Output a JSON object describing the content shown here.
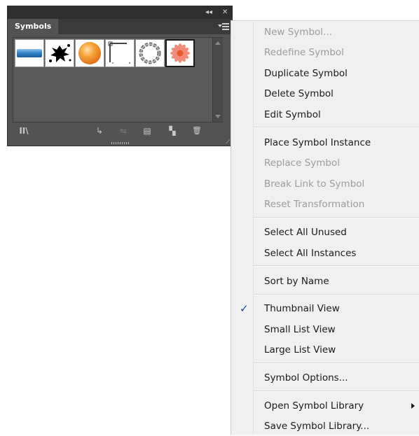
{
  "panel": {
    "tab_label": "Symbols",
    "collapse_glyph": "◂◂",
    "close_glyph": "✕",
    "thumbnails": [
      {
        "name": "blue-bar-symbol-icon",
        "color": "#2f7fc4"
      },
      {
        "name": "ink-splat-symbol-icon",
        "color": "#000000"
      },
      {
        "name": "orange-ball-symbol-icon",
        "color": "#f08a1c"
      },
      {
        "name": "frame-corner-symbol-icon",
        "color": "#555555"
      },
      {
        "name": "chain-ring-symbol-icon",
        "color": "#777777"
      },
      {
        "name": "flower-symbol-icon",
        "color": "#f07060"
      }
    ],
    "footer": {
      "library_glyph": "II\\",
      "place_glyph": "↳",
      "break_link_glyph": "⇋",
      "options_glyph": "▤",
      "new_glyph": "▚",
      "delete_glyph": "🗑"
    }
  },
  "menu": {
    "items": [
      {
        "label": "New Symbol...",
        "enabled": false
      },
      {
        "label": "Redefine Symbol",
        "enabled": false
      },
      {
        "label": "Duplicate Symbol",
        "enabled": true
      },
      {
        "label": "Delete Symbol",
        "enabled": true
      },
      {
        "label": "Edit Symbol",
        "enabled": true
      },
      {
        "label": "Place Symbol Instance",
        "enabled": true
      },
      {
        "label": "Replace Symbol",
        "enabled": false
      },
      {
        "label": "Break Link to Symbol",
        "enabled": false
      },
      {
        "label": "Reset Transformation",
        "enabled": false
      },
      {
        "label": "Select All Unused",
        "enabled": true
      },
      {
        "label": "Select All Instances",
        "enabled": true
      },
      {
        "label": "Sort by Name",
        "enabled": true
      },
      {
        "label": "Thumbnail View",
        "enabled": true,
        "checked": true
      },
      {
        "label": "Small List View",
        "enabled": true
      },
      {
        "label": "Large List View",
        "enabled": true
      },
      {
        "label": "Symbol Options...",
        "enabled": true
      },
      {
        "label": "Open Symbol Library",
        "enabled": true,
        "submenu": true
      },
      {
        "label": "Save Symbol Library...",
        "enabled": true
      }
    ],
    "check_glyph": "✓"
  }
}
